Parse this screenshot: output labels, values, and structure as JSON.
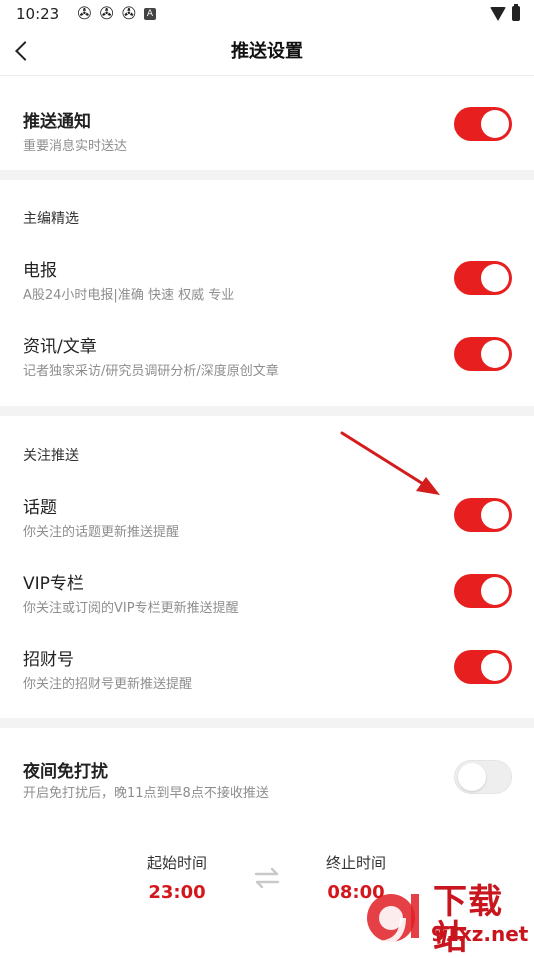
{
  "status_bar": {
    "time": "10:23",
    "notification_icons": [
      "aperture-icon",
      "aperture-icon",
      "aperture-icon",
      "a-icon"
    ],
    "a_icon_label": "A"
  },
  "header": {
    "title": "推送设置",
    "back_icon": "chevron-left-icon"
  },
  "push_notification": {
    "title": "推送通知",
    "subtitle": "重要消息实时送达",
    "enabled": true
  },
  "editor_picks": {
    "label": "主编精选",
    "items": [
      {
        "title": "电报",
        "subtitle": "A股24小时电报|准确 快速 权威 专业",
        "enabled": true
      },
      {
        "title": "资讯/文章",
        "subtitle": "记者独家采访/研究员调研分析/深度原创文章",
        "enabled": true
      }
    ]
  },
  "follow_push": {
    "label": "关注推送",
    "items": [
      {
        "title": "话题",
        "subtitle": "你关注的话题更新推送提醒",
        "enabled": true
      },
      {
        "title": "VIP专栏",
        "subtitle": "你关注或订阅的VIP专栏更新推送提醒",
        "enabled": true
      },
      {
        "title": "招财号",
        "subtitle": "你关注的招财号更新推送提醒",
        "enabled": true
      }
    ]
  },
  "dnd": {
    "title": "夜间免打扰",
    "subtitle": "开启免打扰后，晚11点到早8点不接收推送",
    "enabled": false,
    "start_label": "起始时间",
    "start_value": "23:00",
    "end_label": "终止时间",
    "end_value": "08:00"
  },
  "watermark": {
    "title": "下载站",
    "url": "91xz.net"
  },
  "colors": {
    "accent": "#e7201f",
    "time_value": "#d4161d",
    "toggle_off": "#eeeeee",
    "separator": "#f3f3f3"
  }
}
